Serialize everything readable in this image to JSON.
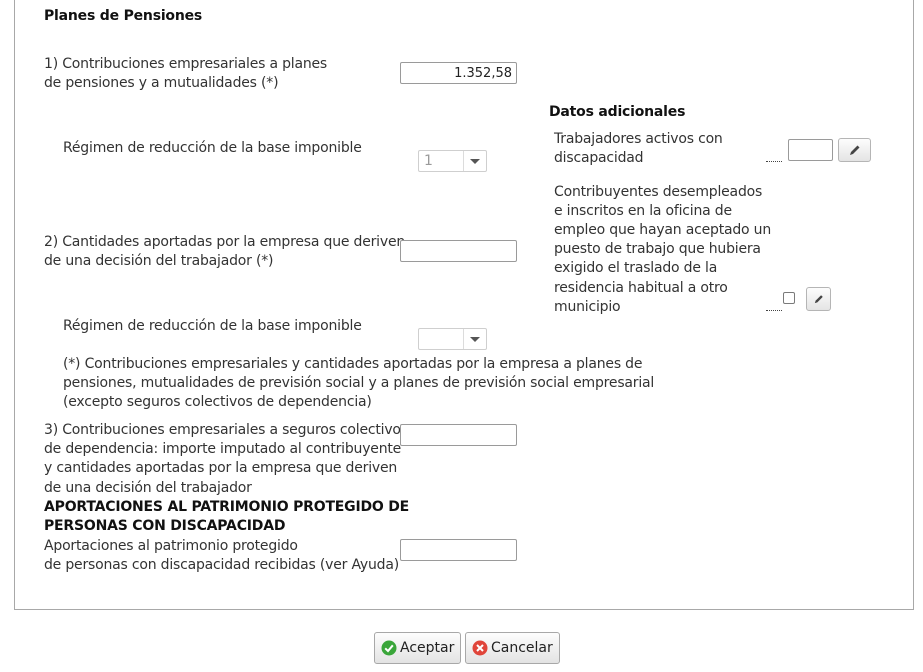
{
  "planes": {
    "title": "Planes de Pensiones",
    "q1": {
      "line1": "1) Contribuciones empresariales a planes",
      "line2": "de pensiones y a mutualidades (*)",
      "value": "1.352,58"
    },
    "regimen1": {
      "label": "Régimen de reducción de la base imponible",
      "selected": "1"
    },
    "q2": {
      "line1": "2) Cantidades aportadas por la empresa que deriven",
      "line2": "de una decisión del trabajador (*)",
      "value": ""
    },
    "regimen2": {
      "label": "Régimen de reducción de la base imponible",
      "selected": ""
    },
    "note": {
      "line1": "(*) Contribuciones empresariales y cantidades aportadas por la empresa a planes de",
      "line2": "pensiones, mutualidades de previsión social y a planes de previsión social empresarial",
      "line3": "(excepto seguros colectivos de dependencia)"
    },
    "q3": {
      "line1": "3) Contribuciones empresariales a seguros colectivos",
      "line2": "de dependencia: importe imputado al contribuyente",
      "line3": "y cantidades aportadas por la empresa que deriven",
      "line4": "de una decisión del trabajador",
      "value": ""
    }
  },
  "patrimonio": {
    "title_line1": "APORTACIONES AL PATRIMONIO PROTEGIDO DE",
    "title_line2": "PERSONAS CON DISCAPACIDAD",
    "label_line1": "Aportaciones al patrimonio protegido",
    "label_line2": "de personas con discapacidad recibidas (ver Ayuda)",
    "value": ""
  },
  "datos": {
    "title": "Datos adicionales",
    "trabajadores": {
      "line1": "Trabajadores activos con",
      "line2": "discapacidad",
      "value": ""
    },
    "desempleados": {
      "lines": [
        "Contribuyentes desempleados",
        "e inscritos en la oficina de",
        "empleo que hayan aceptado un",
        "puesto de trabajo que hubiera",
        "exigido el traslado de la",
        "residencia habitual a otro",
        "municipio"
      ]
    }
  },
  "buttons": {
    "accept": "Aceptar",
    "cancel": "Cancelar"
  },
  "icons": {
    "edit": "pencil-icon",
    "accept": "check-circle-icon",
    "cancel": "x-circle-icon"
  },
  "colors": {
    "accept_icon": "#3aa63a",
    "cancel_icon": "#e0453a",
    "border": "#a8a8a8"
  }
}
